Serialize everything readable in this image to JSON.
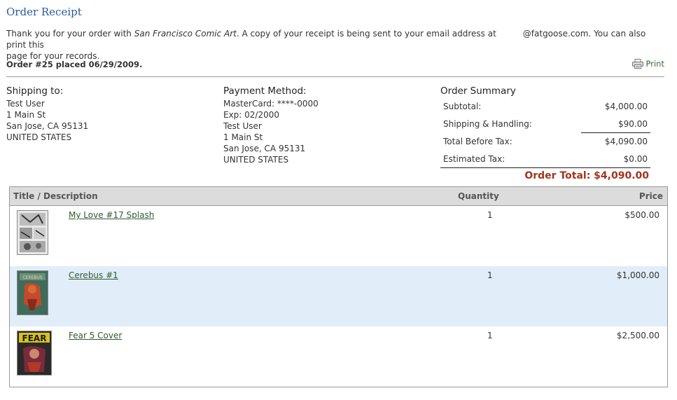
{
  "page": {
    "title": "Order Receipt"
  },
  "message": {
    "pre": "Thank you for your order with ",
    "store": "San Francisco Comic Art",
    "post_line1": ". A copy of your receipt is being sent to your email address at",
    "email_domain": "@fatgoose.com. You can also print this",
    "post_line2": "page for your records."
  },
  "order": {
    "heading": "Order #25 placed 06/29/2009.",
    "print_label": "Print"
  },
  "shipping": {
    "heading": "Shipping to:",
    "name": "Test User",
    "street": "1 Main St",
    "city": "San Jose, CA 95131",
    "country": "UNITED STATES"
  },
  "payment": {
    "heading": "Payment Method:",
    "card": "MasterCard: ****-0000",
    "exp": "Exp: 02/2000",
    "name": "Test User",
    "street": "1 Main St",
    "city": "San Jose, CA 95131",
    "country": "UNITED STATES"
  },
  "summary": {
    "heading": "Order Summary",
    "rows": [
      {
        "label": "Subtotal:",
        "value": "$4,000.00"
      },
      {
        "label": "Shipping & Handling:",
        "value": "$90.00"
      },
      {
        "label": "Total Before Tax:",
        "value": "$4,090.00"
      },
      {
        "label": "Estimated Tax:",
        "value": "$0.00"
      }
    ],
    "order_total": "Order Total: $4,090.00"
  },
  "items": {
    "columns": {
      "title": "Title / Description",
      "quantity": "Quantity",
      "price": "Price"
    },
    "rows": [
      {
        "name": "My Love #17 Splash",
        "quantity": "1",
        "price": "$500.00"
      },
      {
        "name": "Cerebus #1",
        "quantity": "1",
        "price": "$1,000.00"
      },
      {
        "name": "Fear 5 Cover",
        "quantity": "1",
        "price": "$2,500.00"
      }
    ]
  },
  "colors": {
    "title": "#2a5a9a",
    "total": "#a0361d",
    "link": "#2f5a2f",
    "row_alt": "#e1edf9",
    "header_bg": "#dcdcdc"
  }
}
